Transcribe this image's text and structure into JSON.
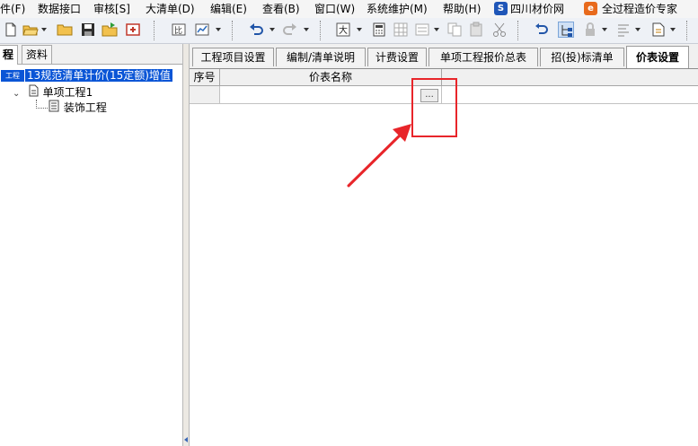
{
  "menu": {
    "items": [
      "件(F)",
      "数据接口",
      "审核[S]",
      "大清单(D)",
      "编辑(E)",
      "查看(B)",
      "窗口(W)",
      "系统维护(M)",
      "帮助(H)"
    ],
    "links": [
      "四川材价网",
      "全过程造价专家"
    ]
  },
  "toolbar": {
    "icons": [
      "new-file-icon",
      "open-folder-icon",
      "folder-icon",
      "save-icon",
      "export-icon",
      "print-icon",
      "compare-icon",
      "chart-icon",
      "undo-icon",
      "redo-icon",
      "text-size-icon",
      "calculator-icon",
      "grid-icon",
      "list-icon",
      "copy-icon",
      "paste-icon",
      "cut-icon",
      "revert-icon",
      "tree-icon",
      "lock-icon",
      "align-icon",
      "document-icon"
    ]
  },
  "left_panel": {
    "tabs": [
      "程",
      "资料"
    ],
    "tree": {
      "root_label": "13规范清单计价(15定额)增值",
      "root_badge": "工程",
      "child_label": "单项工程1",
      "grandchild_label": "装饰工程"
    }
  },
  "main_tabs": [
    "工程项目设置",
    "编制/清单说明",
    "计费设置",
    "单项工程报价总表",
    "招(投)标清单",
    "价表设置"
  ],
  "active_tab": "价表设置",
  "grid": {
    "columns": [
      "序号",
      "价表名称"
    ],
    "ellipsis_label": "..."
  },
  "colors": {
    "selection": "#0a55d6",
    "annotation": "#e8252a"
  }
}
